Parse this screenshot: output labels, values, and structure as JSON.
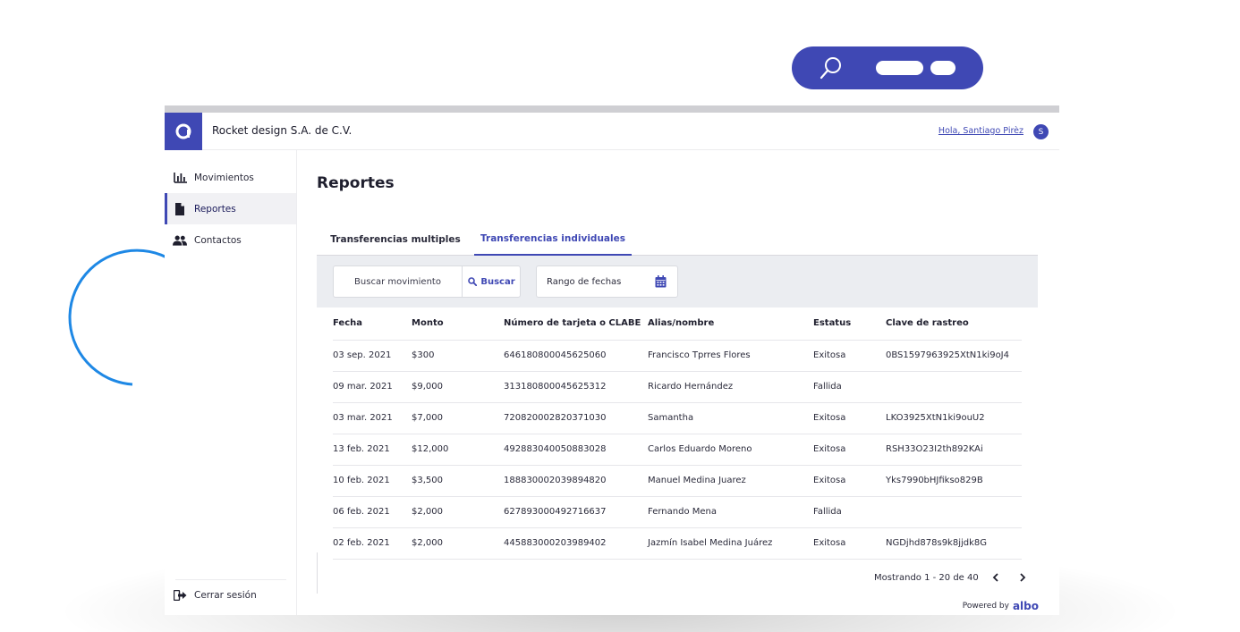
{
  "header": {
    "company": "Rocket design S.A. de C.V.",
    "greeting": "Hola, Santiago Pirèz",
    "avatar_initial": "S"
  },
  "sidebar": {
    "items": [
      {
        "label": "Movimientos",
        "icon": "bar-chart-icon",
        "active": false
      },
      {
        "label": "Reportes",
        "icon": "document-icon",
        "active": true
      },
      {
        "label": "Contactos",
        "icon": "users-icon",
        "active": false
      }
    ],
    "logout_label": "Cerrar sesión"
  },
  "main": {
    "title": "Reportes",
    "tabs": [
      {
        "label": "Transferencias multiples",
        "active": false
      },
      {
        "label": "Transferencias individuales",
        "active": true
      }
    ],
    "filters": {
      "search_placeholder": "Buscar movimiento",
      "search_button": "Buscar",
      "date_range_label": "Rango de fechas"
    },
    "table": {
      "columns": [
        "Fecha",
        "Monto",
        "Número de tarjeta o CLABE",
        "Alias/nombre",
        "Estatus",
        "Clave de rastreo"
      ],
      "rows": [
        [
          "03 sep. 2021",
          "$300",
          "646180800045625060",
          "Francisco Tprres Flores",
          "Exitosa",
          "0BS1597963925XtN1ki9oJ4"
        ],
        [
          "09 mar. 2021",
          "$9,000",
          "313180800045625312",
          "Ricardo Hernández",
          "Fallida",
          ""
        ],
        [
          "03 mar. 2021",
          "$7,000",
          "720820002820371030",
          "Samantha",
          "Exitosa",
          "LKO3925XtN1ki9ouU2"
        ],
        [
          "13 feb. 2021",
          "$12,000",
          "492883040050883028",
          "Carlos Eduardo Moreno",
          "Exitosa",
          "RSH33O23I2th892KAi"
        ],
        [
          "10 feb. 2021",
          "$3,500",
          "188830002039894820",
          "Manuel Medina Juarez",
          "Exitosa",
          "Yks7990bHJfikso829B"
        ],
        [
          "06 feb. 2021",
          "$2,000",
          "627893000492716637",
          "Fernando Mena",
          "Fallida",
          ""
        ],
        [
          "02 feb. 2021",
          "$2,000",
          "445883000203989402",
          "Jazmín Isabel Medina Juárez",
          "Exitosa",
          "NGDjhd878s9k8jjdk8G"
        ]
      ]
    },
    "pagination": {
      "summary": "Mostrando 1 - 20 de 40"
    },
    "footer": {
      "powered_by": "Powered by",
      "brand": "albo"
    }
  },
  "colors": {
    "accent": "#3f48b4",
    "success": "#2e7d32",
    "failure": "#b0192b",
    "arc": "#1e88e5"
  }
}
